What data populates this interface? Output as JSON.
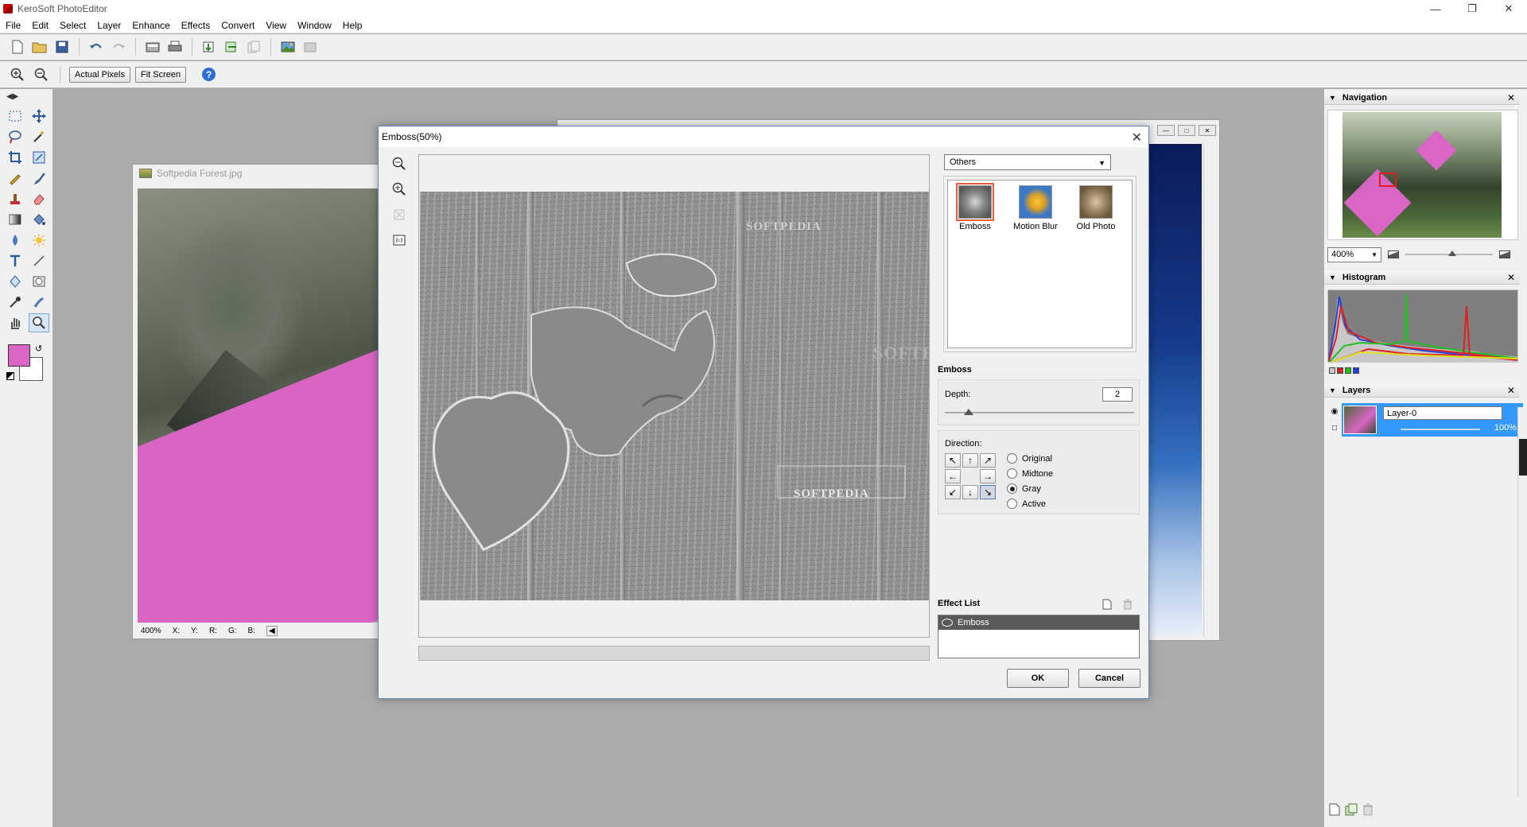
{
  "app": {
    "title": "KeroSoft PhotoEditor"
  },
  "menu": [
    "File",
    "Edit",
    "Select",
    "Layer",
    "Enhance",
    "Effects",
    "Convert",
    "View",
    "Window",
    "Help"
  ],
  "optbar": {
    "actual_pixels": "Actual Pixels",
    "fit_screen": "Fit Screen",
    "help": "?"
  },
  "document": {
    "title": "Softpedia Forest.jpg",
    "status": {
      "zoom": "400%",
      "x": "X:",
      "y": "Y:",
      "r": "R:",
      "g": "G:",
      "b": "B:"
    }
  },
  "dialog": {
    "title": "Emboss(50%)",
    "category": "Others",
    "effects": [
      {
        "label": "Emboss",
        "selected": true
      },
      {
        "label": "Motion Blur",
        "selected": false
      },
      {
        "label": "Old Photo",
        "selected": false
      }
    ],
    "section_title": "Emboss",
    "depth_label": "Depth:",
    "depth_value": "2",
    "direction_label": "Direction:",
    "modes": [
      {
        "label": "Original",
        "checked": false
      },
      {
        "label": "Midtone",
        "checked": false
      },
      {
        "label": "Gray",
        "checked": true
      },
      {
        "label": "Active",
        "checked": false
      }
    ],
    "effect_list_label": "Effect List",
    "effect_list_items": [
      "Emboss"
    ],
    "ok_label": "OK",
    "cancel_label": "Cancel",
    "watermark": "SOFTPEDIA"
  },
  "panels": {
    "navigation": {
      "title": "Navigation",
      "zoom": "400%"
    },
    "histogram": {
      "title": "Histogram"
    },
    "layers": {
      "title": "Layers",
      "layer_name": "Layer-0",
      "opacity": "100%"
    }
  },
  "colors": {
    "foreground": "#d966c4",
    "background": "#ffffff",
    "selection": "#3399ff"
  }
}
